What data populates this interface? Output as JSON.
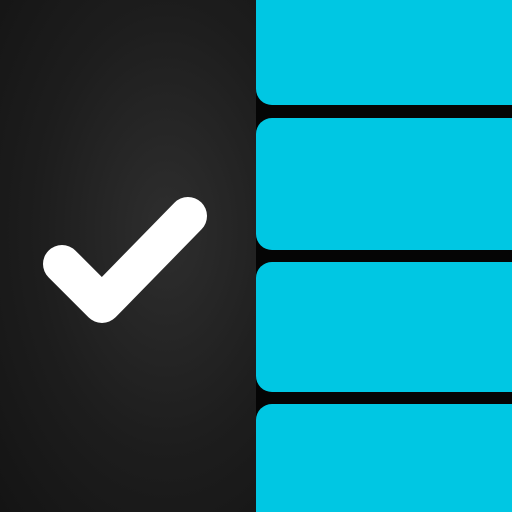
{
  "app_icon": {
    "name": "",
    "colors": {
      "panel_dark": "#1d1d1d",
      "accent_cyan": "#00c7e3",
      "check_white": "#ffffff",
      "divider": "#050505"
    },
    "left_panel": {
      "icon": "checkmark-icon"
    },
    "list_rows": [
      {
        "id": "row-1",
        "label": ""
      },
      {
        "id": "row-2",
        "label": ""
      },
      {
        "id": "row-3",
        "label": ""
      },
      {
        "id": "row-4",
        "label": ""
      }
    ]
  }
}
